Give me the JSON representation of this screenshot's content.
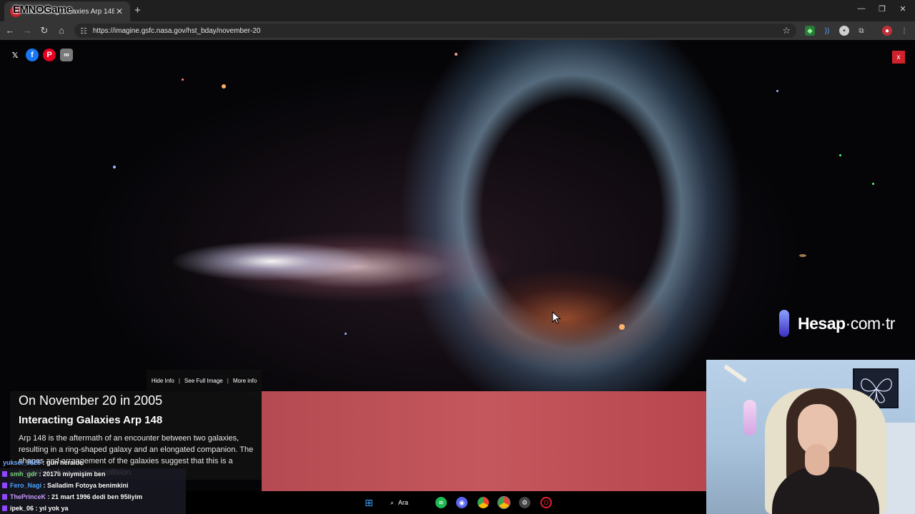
{
  "browser": {
    "tab_title": "Interacting Galaxies Arp 148",
    "tab_logo": "NASA",
    "stream_overlay_name": "EMNOGame",
    "url": "https://imagine.gsfc.nasa.gov/hst_bday/november-20"
  },
  "share": {
    "icons": [
      "x-icon",
      "facebook-icon",
      "pinterest-icon",
      "link-icon"
    ],
    "close_label": "x"
  },
  "watermark": {
    "brand": "Hesap",
    "suffix": "·com·tr"
  },
  "info": {
    "links": [
      "Hide Info",
      "See Full Image",
      "More info"
    ],
    "separator": "|",
    "date": "On November 20 in 2005",
    "title": "Interacting Galaxies Arp 148",
    "description": "Arp 148 is the aftermath of an encounter between two galaxies, resulting in a ring-shaped galaxy and an elongated companion. The shapes and arrangement of the galaxies suggest that this is a snapshot of an ongoing collision."
  },
  "chat": [
    {
      "user": "yuksel_3825",
      "msg": "gün heralde",
      "color": "#6fa8ff"
    },
    {
      "user": "smh_gdr",
      "msg": "2017li miymişim ben",
      "color": "#7cd37c"
    },
    {
      "user": "Fero_Nagi",
      "msg": "Salladim Fotoya benimkini",
      "color": "#4aa3ff"
    },
    {
      "user": "ThePrinceK",
      "msg": "21 mart 1996 dedi ben 95liyim",
      "color": "#c89cff"
    },
    {
      "user": "ipek_06",
      "msg": "yıl yok ya",
      "color": "#ffffff"
    }
  ],
  "taskbar": {
    "search_label": "Ara"
  },
  "colors": {
    "accent_red": "#d0222b",
    "info_band": "#c4575d",
    "chrome_dark": "#1f1f1f",
    "chrome_toolbar": "#353535"
  }
}
